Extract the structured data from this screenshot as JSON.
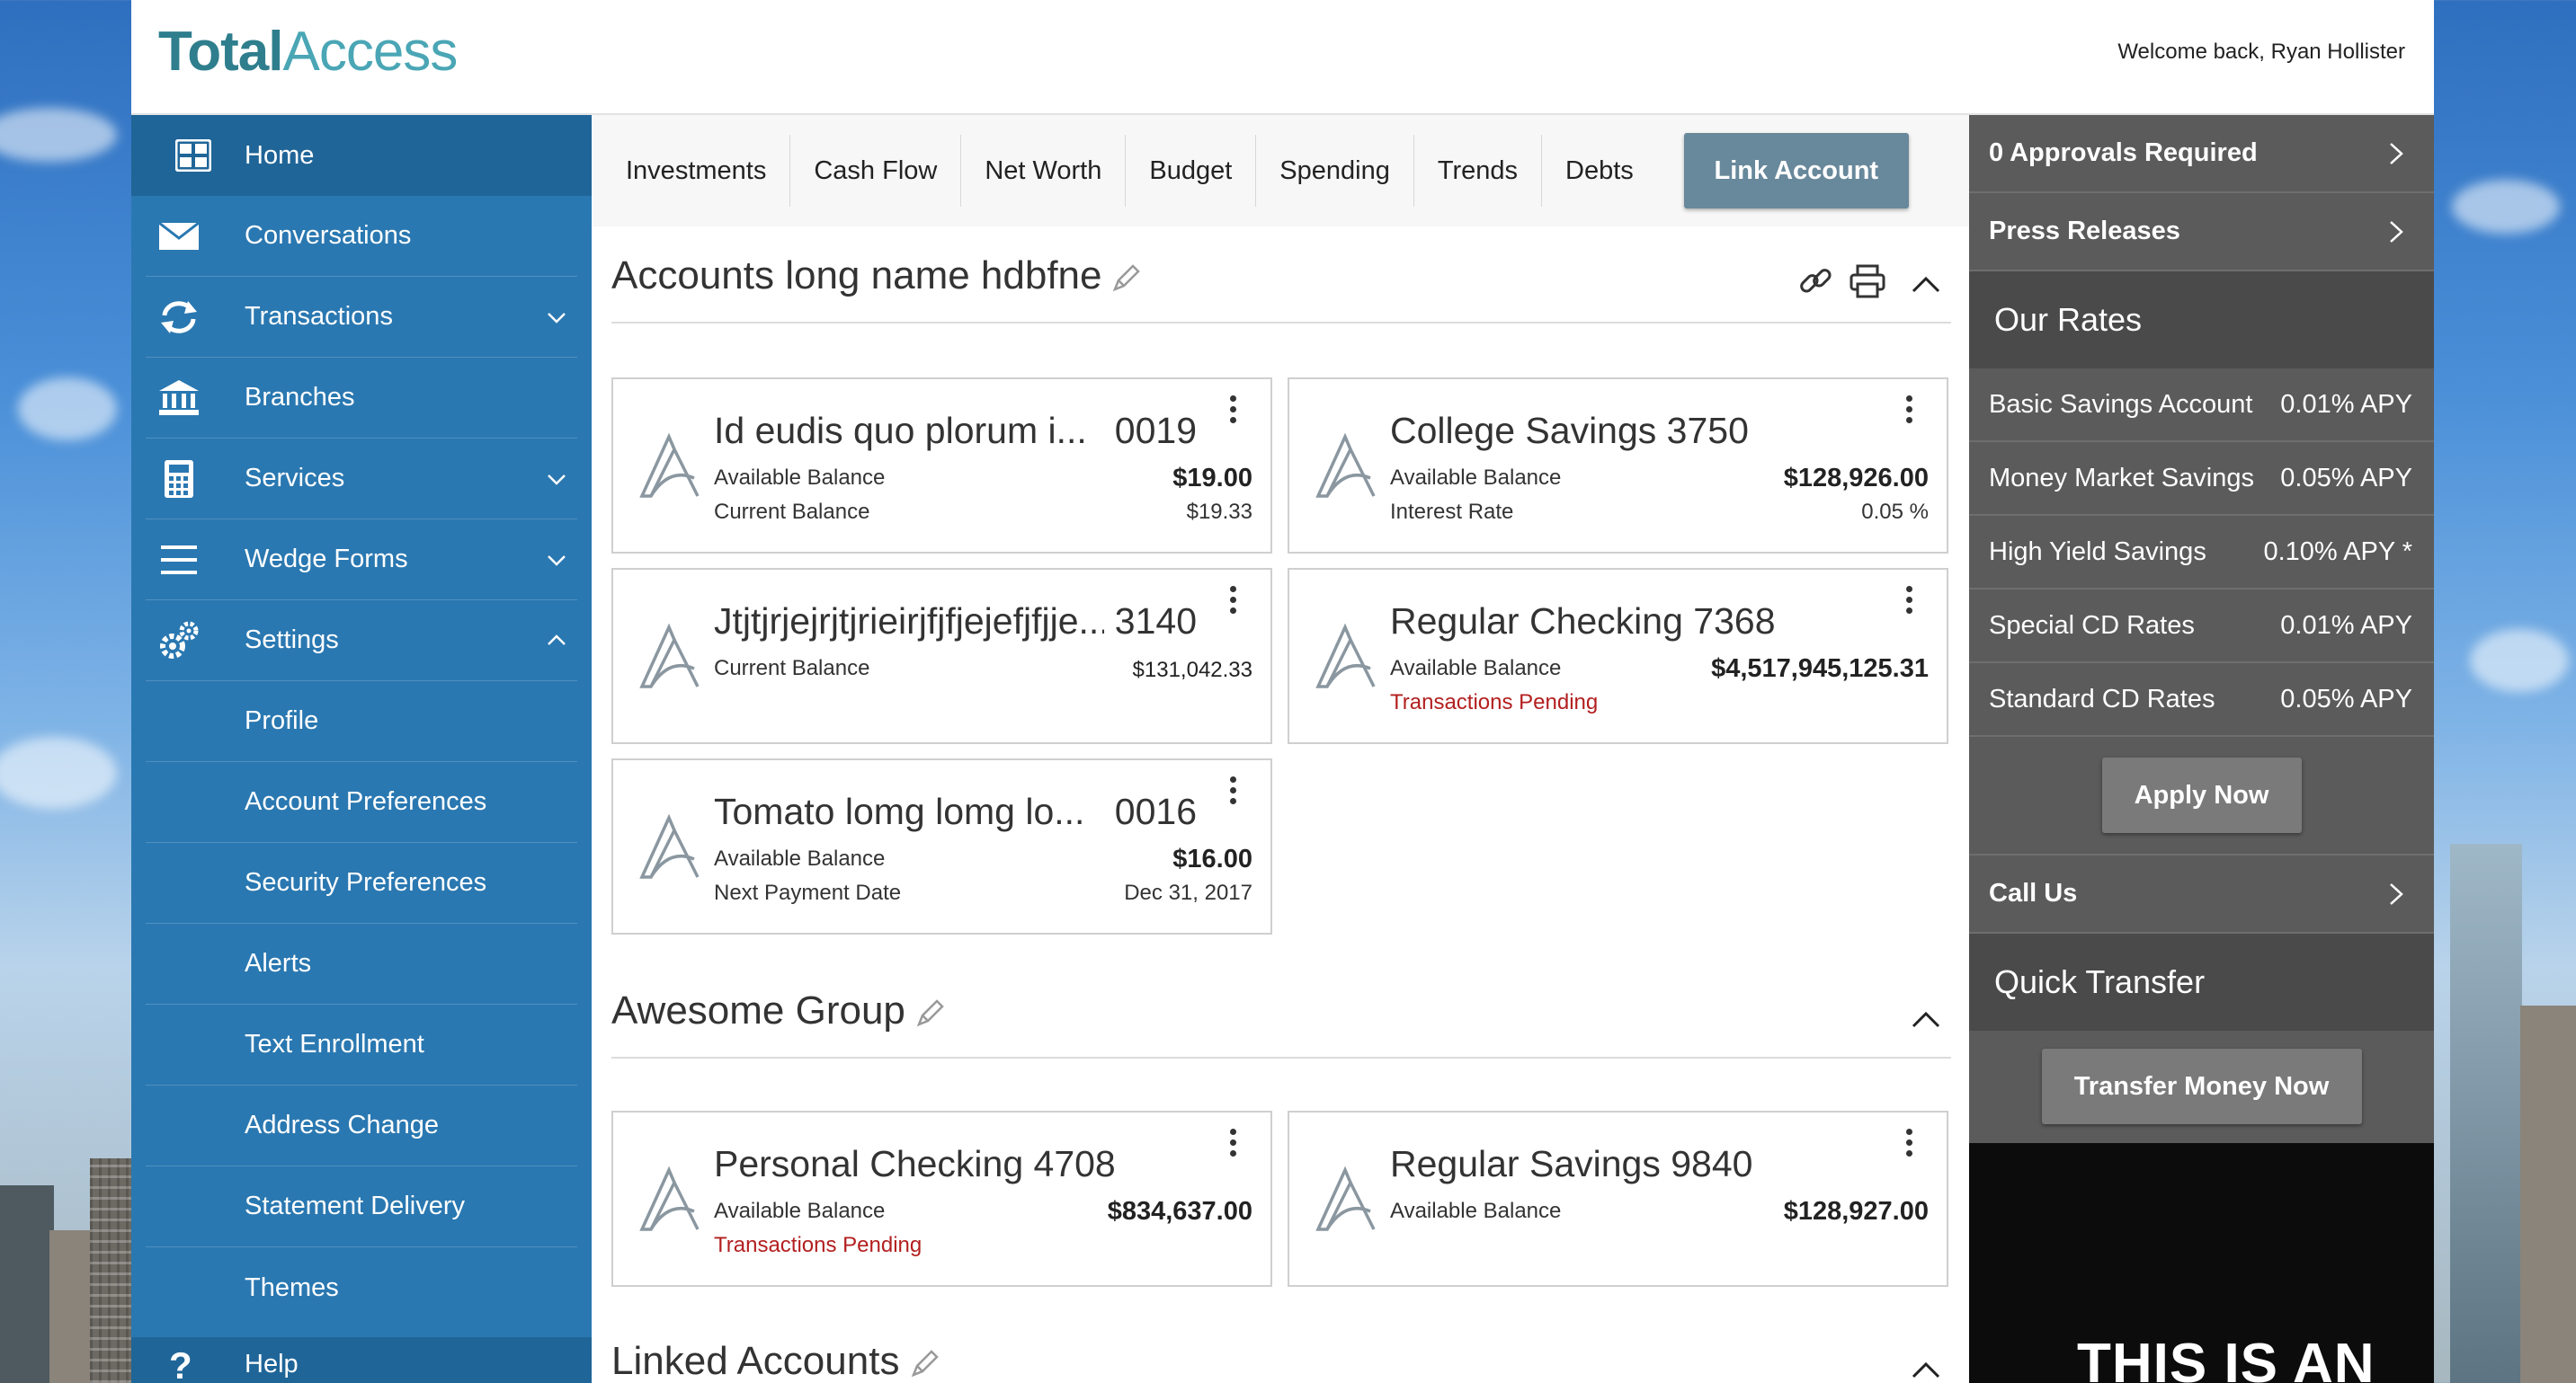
{
  "header": {
    "logo_part1": "Total",
    "logo_part2": "Access",
    "welcome": "Welcome back, Ryan Hollister"
  },
  "sidebar": {
    "items": [
      {
        "label": "Home",
        "icon": "grid-icon"
      },
      {
        "label": "Conversations",
        "icon": "envelope-icon"
      },
      {
        "label": "Transactions",
        "icon": "refresh-icon",
        "expandable": true
      },
      {
        "label": "Branches",
        "icon": "bank-icon"
      },
      {
        "label": "Services",
        "icon": "calculator-icon",
        "expandable": true
      },
      {
        "label": "Wedge Forms",
        "icon": "menu-icon",
        "expandable": true
      },
      {
        "label": "Settings",
        "icon": "gears-icon",
        "expanded": true
      }
    ],
    "settings_sub": [
      "Profile",
      "Account Preferences",
      "Security Preferences",
      "Alerts",
      "Text Enrollment",
      "Address Change",
      "Statement Delivery",
      "Themes"
    ],
    "help": "Help"
  },
  "tabs": [
    "Investments",
    "Cash Flow",
    "Net Worth",
    "Budget",
    "Spending",
    "Trends",
    "Debts"
  ],
  "link_account": "Link Account",
  "groups": [
    {
      "title": "Accounts long name hdbfne",
      "cards": [
        {
          "name": "Id eudis quo plorum i...",
          "number": "0019",
          "label1": "Available Balance",
          "value1": "$19.00",
          "label2": "Current Balance",
          "value2": "$19.33"
        },
        {
          "name": "College Savings 3750",
          "number": "",
          "label1": "Available Balance",
          "value1": "$128,926.00",
          "label2": "Interest Rate",
          "value2": "0.05 %"
        },
        {
          "name": "Jtjtjrjejrjtjrieirjfjfjejefjfjje...",
          "number": "3140",
          "label1": "Current Balance",
          "value1": "$131,042.33",
          "label2": "",
          "value2": ""
        },
        {
          "name": "Regular Checking 7368",
          "number": "",
          "label1": "Available Balance",
          "value1": "$4,517,945,125.31",
          "label2": "Transactions Pending",
          "value2": ""
        },
        {
          "name": "Tomato lomg lomg lo...",
          "number": "0016",
          "label1": "Available Balance",
          "value1": "$16.00",
          "label2": "Next Payment Date",
          "value2": "Dec 31, 2017"
        }
      ]
    },
    {
      "title": "Awesome Group",
      "cards": [
        {
          "name": "Personal Checking 4708",
          "number": "",
          "label1": "Available Balance",
          "value1": "$834,637.00",
          "label2": "Transactions Pending",
          "value2": ""
        },
        {
          "name": "Regular Savings 9840",
          "number": "",
          "label1": "Available Balance",
          "value1": "$128,927.00",
          "label2": "",
          "value2": ""
        }
      ]
    },
    {
      "title": "Linked Accounts",
      "cards": []
    }
  ],
  "right_panel": {
    "approvals": "0  Approvals Required",
    "press": "Press Releases",
    "our_rates": "Our Rates",
    "rates": [
      {
        "name": "Basic Savings Account",
        "value": "0.01% APY"
      },
      {
        "name": "Money Market Savings",
        "value": "0.05% APY"
      },
      {
        "name": "High Yield Savings",
        "value": "0.10% APY *"
      },
      {
        "name": "Special CD Rates",
        "value": "0.01% APY"
      },
      {
        "name": "Standard CD Rates",
        "value": "0.05% APY"
      }
    ],
    "apply_now": "Apply Now",
    "call_us": "Call Us",
    "quick_transfer": "Quick Transfer",
    "transfer_btn": "Transfer Money Now",
    "ad_text": "THIS IS AN"
  },
  "colors": {
    "nav_blue": "#2a78b1",
    "nav_active": "#1f6598",
    "panel_gray": "#5b5b5b",
    "pending_red": "#b31f1f",
    "link_btn": "#68889b"
  }
}
